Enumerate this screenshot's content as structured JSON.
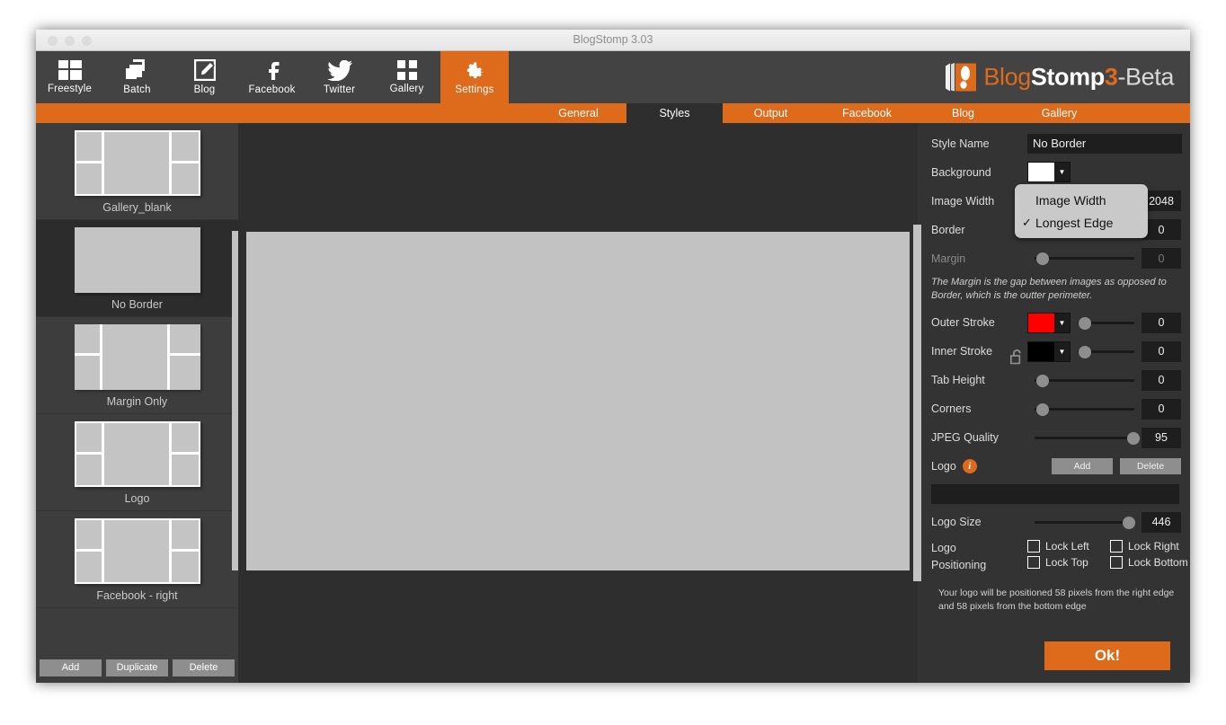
{
  "window": {
    "title": "BlogStomp 3.03",
    "traffic_lights": [
      "close",
      "minimize",
      "zoom"
    ]
  },
  "toolbar": {
    "items": [
      {
        "label": "Freestyle",
        "icon": "grid-layout-icon",
        "active": false
      },
      {
        "label": "Batch",
        "icon": "stacked-squares-icon",
        "active": false
      },
      {
        "label": "Blog",
        "icon": "pencil-square-icon",
        "active": false
      },
      {
        "label": "Facebook",
        "icon": "facebook-f-icon",
        "active": false
      },
      {
        "label": "Twitter",
        "icon": "twitter-bird-icon",
        "active": false
      },
      {
        "label": "Gallery",
        "icon": "four-squares-icon",
        "active": false
      },
      {
        "label": "Settings",
        "icon": "gear-icon",
        "active": true
      }
    ],
    "brand": {
      "icon": "bootprint-logo-icon",
      "part1": "Blog",
      "part2": "Stomp",
      "part3": "3",
      "part4": "-Beta"
    }
  },
  "tabs": [
    {
      "label": "General",
      "active": false
    },
    {
      "label": "Styles",
      "active": true
    },
    {
      "label": "Output",
      "active": false
    },
    {
      "label": "Facebook",
      "active": false
    },
    {
      "label": "Blog",
      "active": false
    },
    {
      "label": "Gallery",
      "active": false
    }
  ],
  "sidebar": {
    "styles": [
      {
        "name": "Gallery_blank",
        "selected": false,
        "layout": "multi"
      },
      {
        "name": "No Border",
        "selected": true,
        "layout": "plain"
      },
      {
        "name": "Margin Only",
        "selected": false,
        "layout": "multi"
      },
      {
        "name": "Logo",
        "selected": false,
        "layout": "multi"
      },
      {
        "name": "Facebook - right",
        "selected": false,
        "layout": "multi"
      }
    ],
    "actions": [
      {
        "label": "Add"
      },
      {
        "label": "Duplicate"
      },
      {
        "label": "Delete"
      }
    ]
  },
  "panel": {
    "style_name": {
      "label": "Style Name",
      "value": "No Border"
    },
    "background": {
      "label": "Background",
      "color": "#ffffff"
    },
    "image_width": {
      "label": "Image Width",
      "value": "2048",
      "knob_pct": 46
    },
    "border": {
      "label": "Border",
      "value": "0",
      "knob_pct": 2
    },
    "margin": {
      "label": "Margin",
      "value": "0",
      "knob_pct": 2,
      "disabled": true
    },
    "margin_help": "The Margin is the gap between images as opposed to Border, which is the outter perimeter.",
    "outer_stroke": {
      "label": "Outer Stroke",
      "color": "#ff0000",
      "value": "0",
      "knob_pct": 2
    },
    "inner_stroke": {
      "label": "Inner Stroke",
      "color": "#000000",
      "value": "0",
      "knob_pct": 2
    },
    "tab_height": {
      "label": "Tab Height",
      "value": "0",
      "knob_pct": 2
    },
    "corners": {
      "label": "Corners",
      "value": "0",
      "knob_pct": 2
    },
    "jpeg_quality": {
      "label": "JPEG Quality",
      "value": "95",
      "knob_pct": 93
    },
    "logo": {
      "label": "Logo",
      "info_icon": "info-icon",
      "add_label": "Add",
      "delete_label": "Delete",
      "path_value": ""
    },
    "logo_size": {
      "label": "Logo Size",
      "value": "446",
      "knob_pct": 88
    },
    "logo_positioning": {
      "label_line1": "Logo",
      "label_line2": "Positioning",
      "checkboxes": [
        {
          "label": "Lock Left",
          "checked": false
        },
        {
          "label": "Lock Right",
          "checked": false
        },
        {
          "label": "Lock Top",
          "checked": false
        },
        {
          "label": "Lock Bottom",
          "checked": false
        }
      ]
    },
    "logo_note": "Your logo will be positioned 58 pixels from the right edge and 58 pixels from the bottom edge",
    "ok_label": "Ok!",
    "lock_icon": "open-padlock-icon"
  },
  "dropdown": {
    "options": [
      {
        "label": "Image Width",
        "checked": false
      },
      {
        "label": "Longest Edge",
        "checked": true
      }
    ],
    "check_glyph": "✓"
  },
  "colors": {
    "accent": "#dd6b1b",
    "toolbar_bg": "#434343",
    "panel_bg": "#333333",
    "canvas_bg": "#2e2e2e",
    "sidebar_bg": "#3d3d3d",
    "preview_fill": "#c2c2c2"
  }
}
